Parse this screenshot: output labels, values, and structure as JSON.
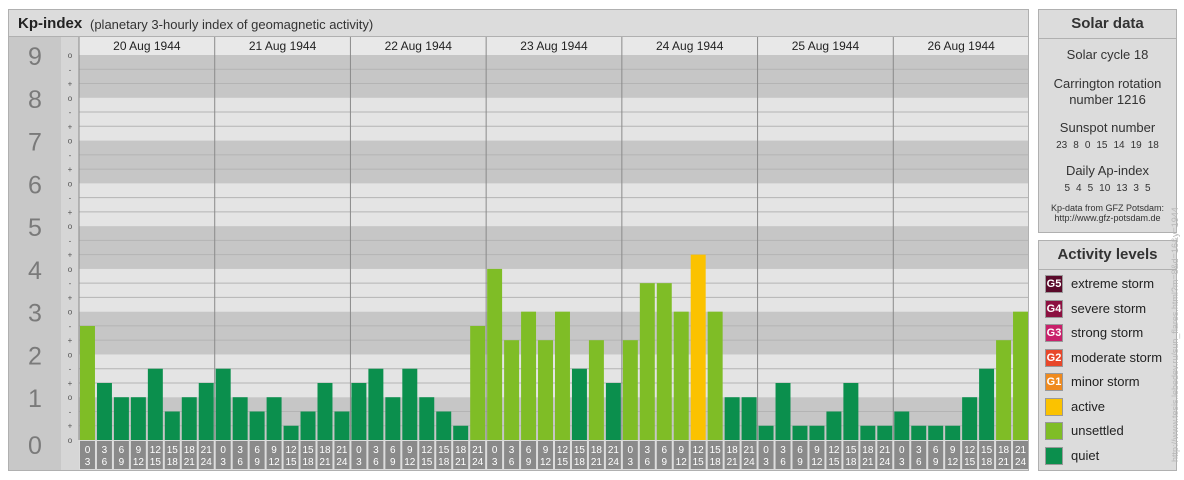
{
  "header": {
    "title": "Kp-index",
    "subtitle": "(planetary 3-hourly index of geomagnetic activity)"
  },
  "chart_data": {
    "type": "bar",
    "title": "Kp-index",
    "subtitle": "(planetary 3-hourly index of geomagnetic activity)",
    "ylim": [
      0,
      9
    ],
    "y_ticks": [
      "0",
      "1",
      "2",
      "3",
      "4",
      "5",
      "6",
      "7",
      "8",
      "9"
    ],
    "y_subticks": [
      "o",
      "+",
      "-",
      "o"
    ],
    "days": [
      "20 Aug 1944",
      "21 Aug 1944",
      "22 Aug 1944",
      "23 Aug 1944",
      "24 Aug 1944",
      "25 Aug 1944",
      "26 Aug 1944"
    ],
    "hour_start_labels": [
      "0",
      "3",
      "6",
      "9",
      "12",
      "15",
      "18",
      "21"
    ],
    "hour_end_labels": [
      "3",
      "6",
      "9",
      "12",
      "15",
      "18",
      "21",
      "24"
    ],
    "values": [
      2.333,
      1.0,
      0.667,
      0.667,
      1.333,
      0.333,
      0.667,
      1.0,
      1.333,
      0.667,
      0.333,
      0.667,
      0.0,
      0.333,
      1.0,
      0.333,
      1.0,
      1.333,
      0.667,
      1.333,
      0.667,
      0.333,
      0.0,
      2.333,
      3.667,
      2.0,
      2.667,
      2.0,
      2.667,
      1.333,
      2.0,
      1.0,
      2.0,
      3.333,
      3.333,
      2.667,
      4.0,
      2.667,
      0.667,
      0.667,
      0.0,
      1.0,
      0.0,
      0.0,
      0.333,
      1.0,
      0.0,
      0.0,
      0.333,
      0.0,
      0.0,
      0.0,
      0.667,
      1.333,
      2.0,
      2.667
    ],
    "colors": {
      "quiet": "#0b8f4d",
      "unsettled": "#7fbd26",
      "active": "#fbc200"
    }
  },
  "solar": {
    "title": "Solar data",
    "cycle": "Solar cycle 18",
    "rotation_line1": "Carrington rotation",
    "rotation_line2": "number 1216",
    "sunspot_label": "Sunspot number",
    "sunspot_values": [
      "23",
      "8",
      "0",
      "15",
      "14",
      "19",
      "18"
    ],
    "ap_label": "Daily Ap-index",
    "ap_values": [
      "5",
      "4",
      "5",
      "10",
      "13",
      "3",
      "5"
    ],
    "credit_line1": "Kp-data from GFZ Potsdam:",
    "credit_line2": "http://www.gfz-potsdam.de"
  },
  "levels": {
    "title": "Activity levels",
    "items": [
      {
        "code": "G5",
        "label": "extreme storm",
        "color": "#5a0a2a"
      },
      {
        "code": "G4",
        "label": "severe storm",
        "color": "#8c1040"
      },
      {
        "code": "G3",
        "label": "strong storm",
        "color": "#c8206a"
      },
      {
        "code": "G2",
        "label": "moderate storm",
        "color": "#e8472a"
      },
      {
        "code": "G1",
        "label": "minor storm",
        "color": "#ef8a1e"
      },
      {
        "code": "",
        "label": "active",
        "color": "#fbc200"
      },
      {
        "code": "",
        "label": "unsettled",
        "color": "#7fbd26"
      },
      {
        "code": "",
        "label": "quiet",
        "color": "#0b8f4d"
      }
    ]
  },
  "watermark": "http://www.tesis.lebedev.ru/sun_flares.html?m=8&d=16&y=1944"
}
